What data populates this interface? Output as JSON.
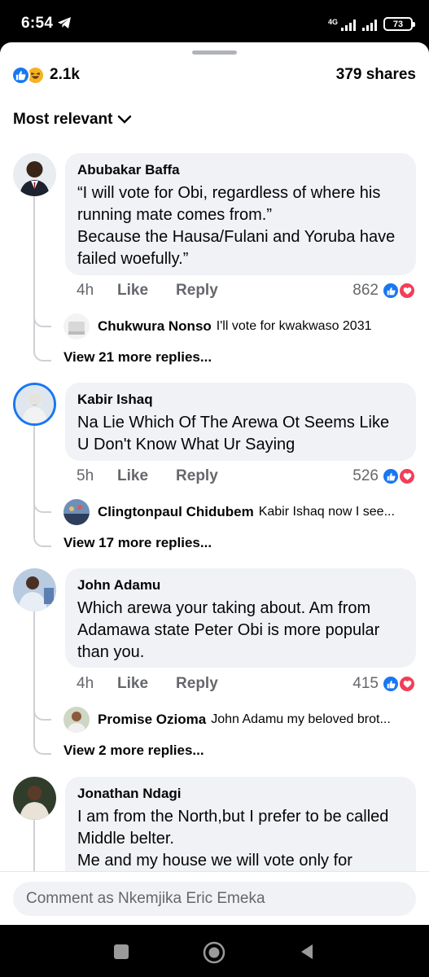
{
  "status_bar": {
    "time": "6:54",
    "network": "4G",
    "battery": "73"
  },
  "post_stats": {
    "reaction_count": "2.1k",
    "shares": "379 shares"
  },
  "sort": {
    "label": "Most relevant"
  },
  "comments": [
    {
      "author": "Abubakar Baffa",
      "text": "“I will vote for Obi, regardless of where his running mate comes from.”\nBecause the Hausa/Fulani and Yoruba have failed woefully.”",
      "time": "4h",
      "like_label": "Like",
      "reply_label": "Reply",
      "reaction_count": "862",
      "reply": {
        "author": "Chukwura Nonso",
        "text": "I'll vote for kwakwaso 2031"
      },
      "view_more": "View 21 more replies..."
    },
    {
      "author": "Kabir Ishaq",
      "text": "Na Lie Which Of The Arewa Ot Seems Like U Don't Know What Ur Saying",
      "time": "5h",
      "like_label": "Like",
      "reply_label": "Reply",
      "reaction_count": "526",
      "reply": {
        "author": "Clingtonpaul Chidubem",
        "text": "Kabir Ishaq  now I see..."
      },
      "view_more": "View 17 more replies..."
    },
    {
      "author": "John Adamu",
      "text": "Which arewa your taking about. Am from Adamawa state Peter Obi is more popular than you.",
      "time": "4h",
      "like_label": "Like",
      "reply_label": "Reply",
      "reaction_count": "415",
      "reply": {
        "author": "Promise Ozioma",
        "text": "John Adamu my beloved brot..."
      },
      "view_more": "View 2 more replies..."
    },
    {
      "author": "Jonathan Ndagi",
      "text": "I am from the North,but I prefer to be called Middle belter.\nMe and my house we will vote only for"
    }
  ],
  "composer": {
    "placeholder": "Comment as Nkemjika Eric Emeka"
  },
  "colors": {
    "like_blue": "#1877f2",
    "love_red": "#f33e58",
    "haha_yellow": "#f7b125",
    "bubble_gray": "#f0f2f5"
  },
  "icons": [
    "telegram-icon",
    "signal-icon",
    "wifi-icon",
    "battery-icon",
    "like-icon",
    "haha-icon",
    "love-icon",
    "chevron-down-icon",
    "stop-icon",
    "home-icon",
    "back-icon"
  ]
}
